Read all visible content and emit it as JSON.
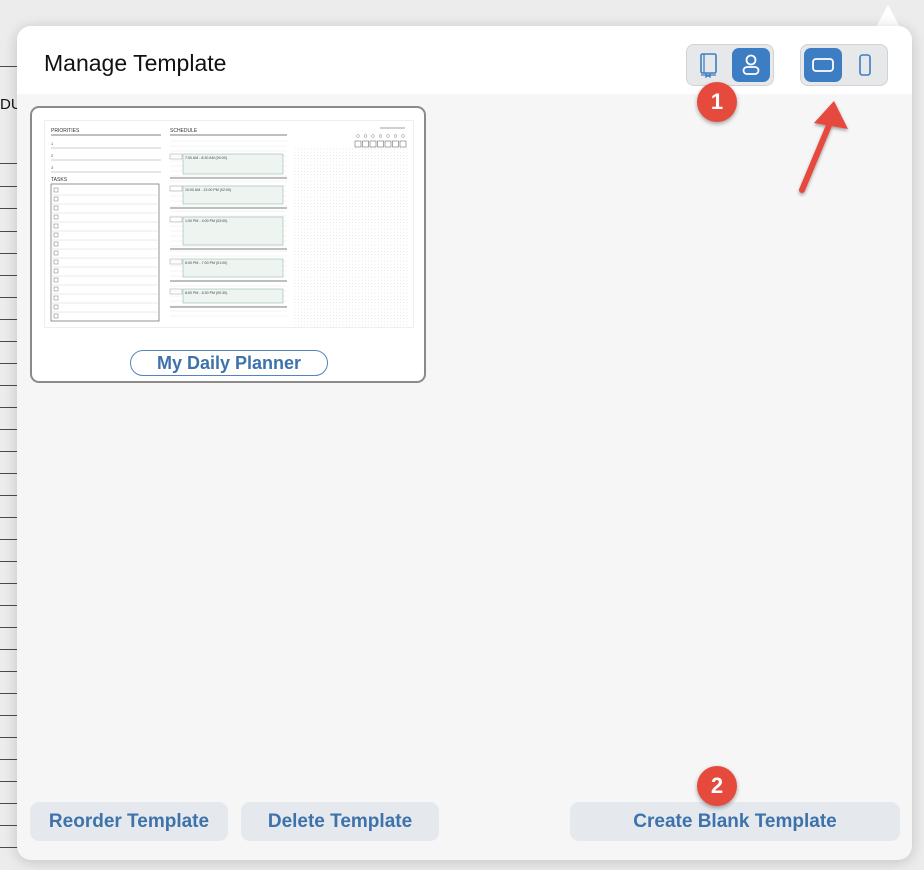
{
  "background": {
    "partial_text": "DU"
  },
  "dialog": {
    "title": "Manage Template",
    "view_toggle": {
      "options": [
        "book-icon",
        "person-icon"
      ],
      "selected": "person-icon"
    },
    "orientation_toggle": {
      "options": [
        "landscape-icon",
        "portrait-icon"
      ],
      "selected": "landscape-icon"
    }
  },
  "templates": [
    {
      "name": "My Daily Planner",
      "thumbnail": {
        "priorities_label": "PRIORITIES",
        "priority_numbers": [
          "1",
          "2",
          "3"
        ],
        "tasks_label": "TASKS",
        "schedule_label": "SCHEDULE",
        "slots": [
          "7:00 AM - 8:30 AM (00:00)",
          "10:00 AM - 12:00 PM (02:00)",
          "1:00 PM - 4:00 PM (03:00)",
          "6:00 PM - 7:00 PM (01:00)",
          "8:00 PM - 8:30 PM (00:30)"
        ]
      }
    }
  ],
  "buttons": {
    "reorder": "Reorder Template",
    "delete": "Delete Template",
    "create_blank": "Create Blank Template"
  },
  "annotations": {
    "badge_1": "1",
    "badge_2": "2"
  },
  "colors": {
    "accent": "#3d7dc4",
    "button_text": "#3d72ab",
    "annotation": "#e64a3c"
  }
}
